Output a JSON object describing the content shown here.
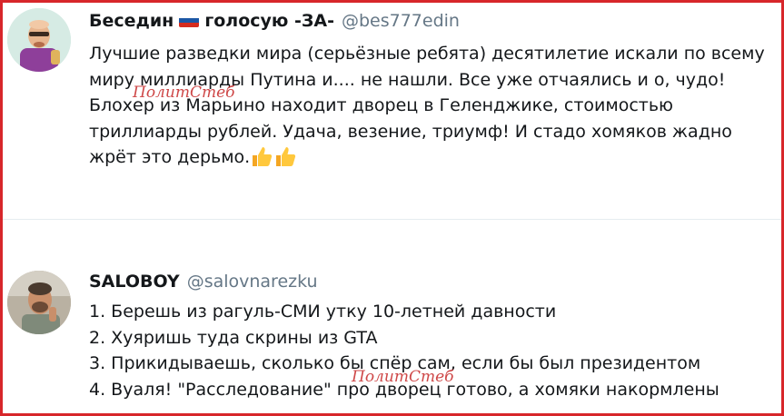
{
  "tweets": [
    {
      "author_name": "Беседин",
      "author_name_suffix": "голосую -ЗА-",
      "flag_icon": "russia-flag-icon",
      "handle": "@bes777edin",
      "lines": [
        "Лучшие разведки мира (серьёзные ребята) десятилетие искали по всему",
        "миру миллиарды Путина и.... не нашли. Все уже отчаялись и о, чудо!",
        "Блохер из Марьино находит дворец в Геленджике, стоимостью",
        "триллиарды рублей. Удача, везение, триумф! И стадо хомяков жадно",
        "жрёт это дерьмо."
      ],
      "emoji": [
        "thumbs-up-icon",
        "thumbs-up-icon"
      ],
      "watermark": "ПолитСтеб"
    },
    {
      "author_name": "SALOBOY",
      "handle": "@salovnarezku",
      "lines": [
        "1. Берешь из рагуль-СМИ утку 10-летней давности",
        "2. Хуяришь туда скрины из GTA",
        "3. Прикидываешь, сколько бы спёр сам, если бы был президентом",
        "4. Вуаля! \"Расследование\" про дворец готово, а хомяки накормлены"
      ],
      "watermark": "ПолитСтеб"
    }
  ],
  "colors": {
    "frame_border": "#d7262b",
    "text": "#14171a",
    "handle": "#657786",
    "divider": "#e6ecf0",
    "watermark": "#c62828"
  }
}
